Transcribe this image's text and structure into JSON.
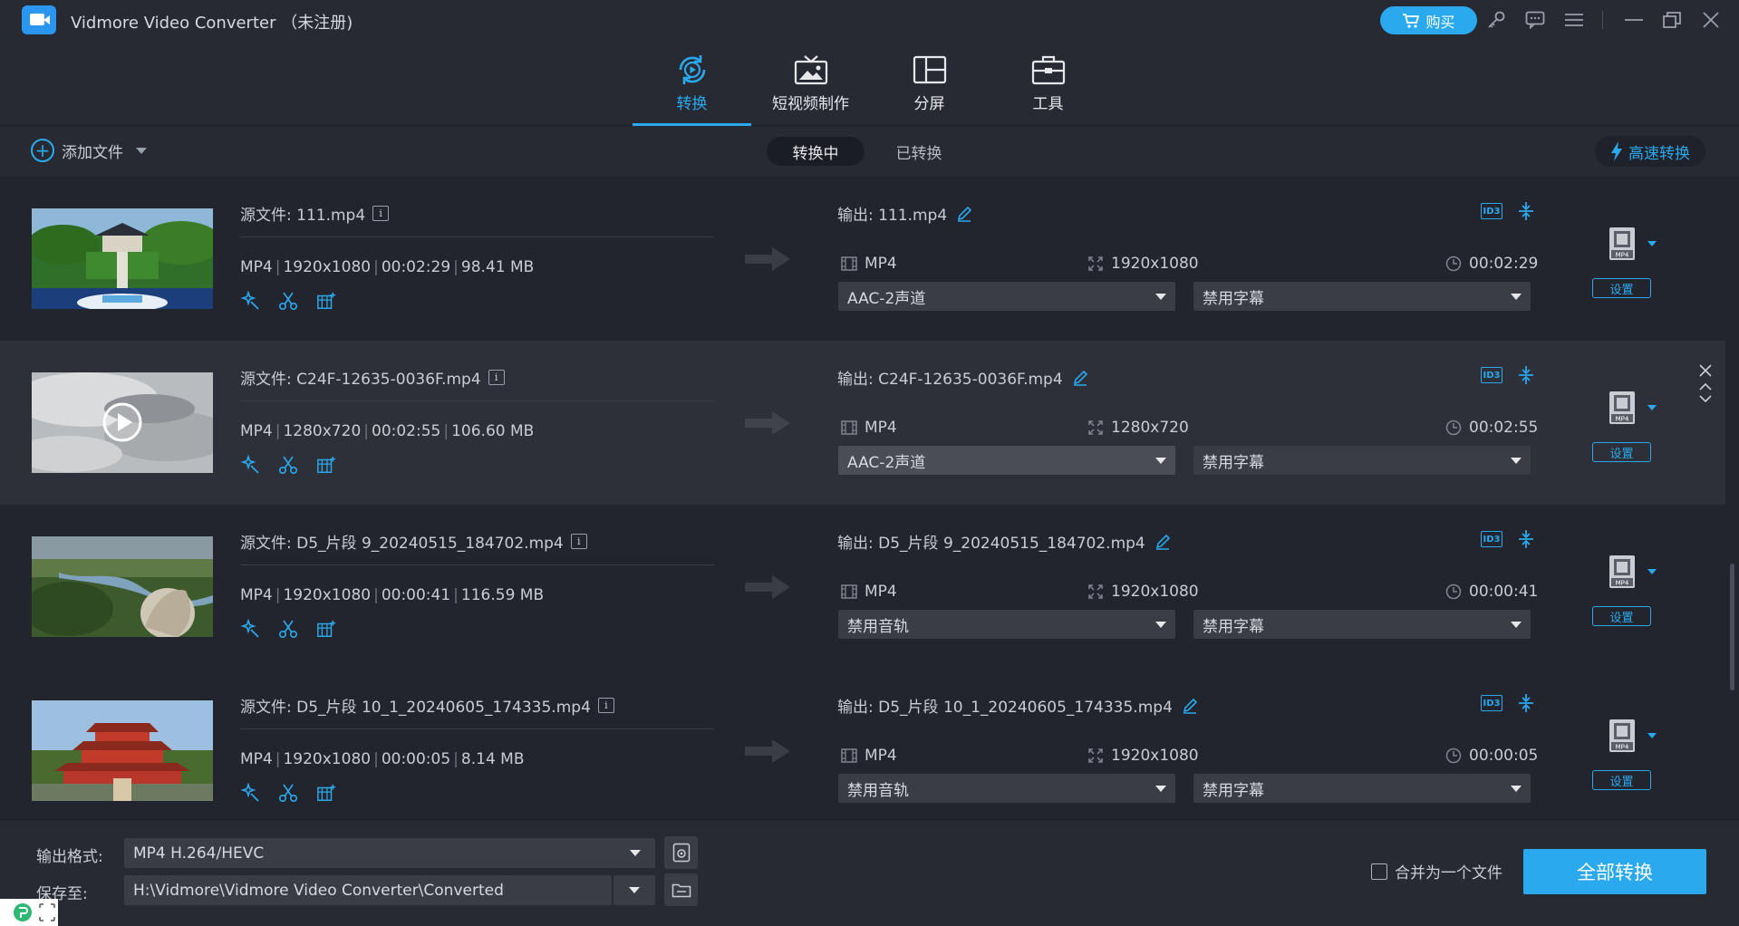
{
  "app": {
    "title": "Vidmore Video Converter （未注册)",
    "buy_label": "购买"
  },
  "nav": {
    "tabs": [
      {
        "label": "转换"
      },
      {
        "label": "短视频制作"
      },
      {
        "label": "分屏"
      },
      {
        "label": "工具"
      }
    ]
  },
  "toolbar": {
    "add_file": "添加文件",
    "converting": "转换中",
    "converted": "已转换",
    "fast_convert": "高速转换"
  },
  "files": [
    {
      "source_prefix": "源文件: 111.mp4",
      "meta_format": "MP4",
      "meta_res": "1920x1080",
      "meta_dur": "00:02:29",
      "meta_size": "98.41 MB",
      "output": "输出: 111.mp4",
      "out_format": "MP4",
      "out_res": "1920x1080",
      "out_dur": "00:02:29",
      "audio": "AAC-2声道",
      "subtitle": "禁用字幕",
      "settings": "设置"
    },
    {
      "source_prefix": "源文件: C24F-12635-0036F.mp4",
      "meta_format": "MP4",
      "meta_res": "1280x720",
      "meta_dur": "00:02:55",
      "meta_size": "106.60 MB",
      "output": "输出: C24F-12635-0036F.mp4",
      "out_format": "MP4",
      "out_res": "1280x720",
      "out_dur": "00:02:55",
      "audio": "AAC-2声道",
      "subtitle": "禁用字幕",
      "settings": "设置"
    },
    {
      "source_prefix": "源文件: D5_片段 9_20240515_184702.mp4",
      "meta_format": "MP4",
      "meta_res": "1920x1080",
      "meta_dur": "00:00:41",
      "meta_size": "116.59 MB",
      "output": "输出: D5_片段 9_20240515_184702.mp4",
      "out_format": "MP4",
      "out_res": "1920x1080",
      "out_dur": "00:00:41",
      "audio": "禁用音轨",
      "subtitle": "禁用字幕",
      "settings": "设置"
    },
    {
      "source_prefix": "源文件: D5_片段 10_1_20240605_174335.mp4",
      "meta_format": "MP4",
      "meta_res": "1920x1080",
      "meta_dur": "00:00:05",
      "meta_size": "8.14 MB",
      "output": "输出: D5_片段 10_1_20240605_174335.mp4",
      "out_format": "MP4",
      "out_res": "1920x1080",
      "out_dur": "00:00:05",
      "audio": "禁用音轨",
      "subtitle": "禁用字幕",
      "settings": "设置"
    }
  ],
  "bottom": {
    "format_label": "输出格式:",
    "format_value": "MP4 H.264/HEVC",
    "save_label": "保存至:",
    "save_path": "H:\\Vidmore\\Vidmore Video Converter\\Converted",
    "merge_label": "合并为一个文件",
    "convert_all": "全部转换"
  },
  "colors": {
    "accent": "#2aa9ee",
    "background": "#23252e",
    "panel": "#272a33",
    "selected_row": "#2d3038",
    "dropdown": "#3a3d46"
  },
  "icons": [
    "app-logo",
    "cart-icon",
    "key-icon",
    "chat-icon",
    "menu-icon",
    "minimize-icon",
    "restore-icon",
    "close-icon",
    "convert-icon",
    "tv-icon",
    "split-screen-icon",
    "toolbox-icon",
    "plus-circle-icon",
    "lightning-icon",
    "info-icon",
    "magic-wand-icon",
    "scissors-icon",
    "enhance-icon",
    "arrow-right-icon",
    "edit-pencil-icon",
    "id3-icon",
    "compress-icon",
    "film-icon",
    "resize-icon",
    "clock-icon",
    "mp4-format-icon",
    "play-icon",
    "remove-icon",
    "move-up-icon",
    "move-down-icon",
    "gear-icon",
    "folder-icon"
  ]
}
